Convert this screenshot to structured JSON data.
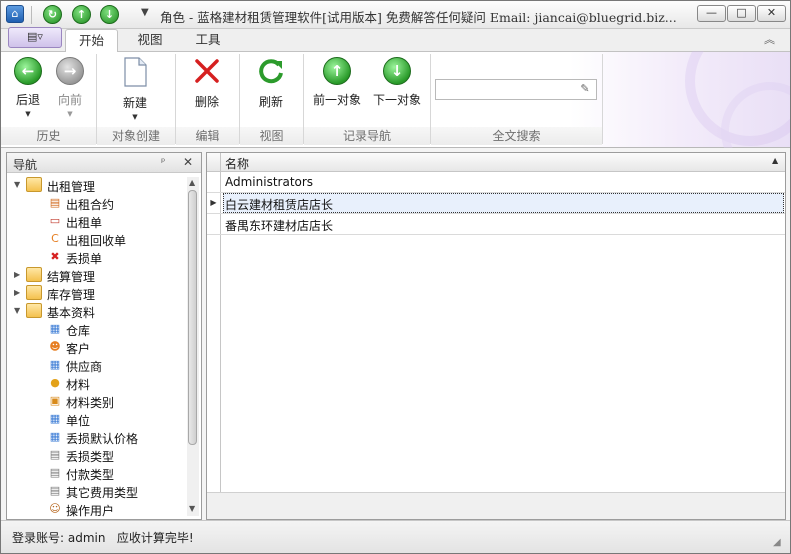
{
  "window": {
    "title": "角色 - 蓝格建材租赁管理软件[试用版本] 免费解答任何疑问 Email: jiancai@bluegrid.biz...",
    "buttons": {
      "minimize": "—",
      "maximize": "□",
      "close": "✕"
    }
  },
  "quick_access": {
    "home_icon": "home-icon",
    "refresh_icon": "refresh-icon",
    "up_icon": "arrow-up-icon",
    "down_icon": "arrow-down-icon",
    "customize_glyph": "▼"
  },
  "app_menu": {
    "glyph": "▤▿"
  },
  "tabs": [
    {
      "label": "开始",
      "active": true
    },
    {
      "label": "视图",
      "active": false
    },
    {
      "label": "工具",
      "active": false
    }
  ],
  "ribbon": {
    "buttons": {
      "back": {
        "label": "后退",
        "enabled": true
      },
      "forward": {
        "label": "向前",
        "enabled": false
      },
      "new": {
        "label": "新建"
      },
      "delete": {
        "label": "删除"
      },
      "refresh": {
        "label": "刷新"
      },
      "prev": {
        "label": "前一对象"
      },
      "next": {
        "label": "下一对象"
      }
    },
    "groups": {
      "history": "历史",
      "create": "对象创建",
      "edit": "编辑",
      "view": "视图",
      "record_nav": "记录导航",
      "search": "全文搜索"
    },
    "search": {
      "value": "",
      "placeholder": ""
    }
  },
  "nav": {
    "title": "导航",
    "pin_glyph": "ᵖ",
    "close_glyph": "✕",
    "tree": [
      {
        "label": "出租管理",
        "level": 0,
        "expanded": true,
        "icon": "folder-icon"
      },
      {
        "label": "出租合约",
        "level": 1,
        "icon": "contract-icon"
      },
      {
        "label": "出租单",
        "level": 1,
        "icon": "document-icon"
      },
      {
        "label": "出租回收单",
        "level": 1,
        "icon": "recycle-icon"
      },
      {
        "label": "丢损单",
        "level": 1,
        "icon": "damage-icon"
      },
      {
        "label": "结算管理",
        "level": 0,
        "expanded": false,
        "icon": "folder-icon"
      },
      {
        "label": "库存管理",
        "level": 0,
        "expanded": false,
        "icon": "folder-icon"
      },
      {
        "label": "基本资料",
        "level": 0,
        "expanded": true,
        "icon": "folder-icon"
      },
      {
        "label": "仓库",
        "level": 1,
        "icon": "warehouse-icon"
      },
      {
        "label": "客户",
        "level": 1,
        "icon": "customer-icon"
      },
      {
        "label": "供应商",
        "level": 1,
        "icon": "supplier-icon"
      },
      {
        "label": "材料",
        "level": 1,
        "icon": "material-icon"
      },
      {
        "label": "材料类别",
        "level": 1,
        "icon": "category-icon"
      },
      {
        "label": "单位",
        "level": 1,
        "icon": "unit-icon"
      },
      {
        "label": "丢损默认价格",
        "level": 1,
        "icon": "price-icon"
      },
      {
        "label": "丢损类型",
        "level": 1,
        "icon": "damage-type-icon"
      },
      {
        "label": "付款类型",
        "level": 1,
        "icon": "payment-type-icon"
      },
      {
        "label": "其它费用类型",
        "level": 1,
        "icon": "fee-type-icon"
      },
      {
        "label": "操作用户",
        "level": 1,
        "icon": "user-icon"
      }
    ]
  },
  "grid": {
    "column": "名称",
    "sort_glyph": "▲",
    "rows": [
      {
        "name": "Administrators",
        "selected": false
      },
      {
        "name": "白云建材租赁店店长",
        "selected": true
      },
      {
        "name": "番禺东环建材店店长",
        "selected": false
      }
    ]
  },
  "status": {
    "text": "登录账号: admin   应收计算完毕!"
  },
  "colors": {
    "accent": "#1e8a1e",
    "ribbon_tint": "#e9dff6",
    "selection": "#e8f0fc"
  }
}
